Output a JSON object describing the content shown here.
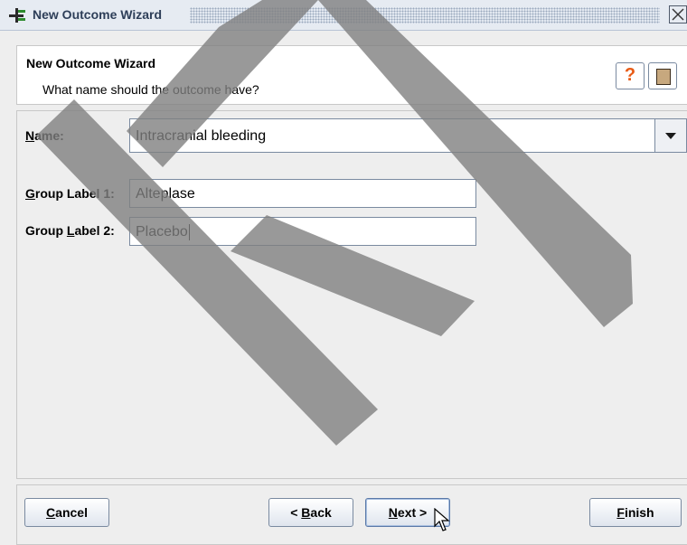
{
  "window": {
    "title": "New Outcome Wizard"
  },
  "header": {
    "title": "New Outcome Wizard",
    "subtitle": "What name should the outcome have?",
    "help_glyph": "?"
  },
  "form": {
    "name": {
      "label_mnemonic": "N",
      "label_rest": "ame:",
      "value": "Intracranial bleeding"
    },
    "group1": {
      "label_mnemonic": "G",
      "label_rest": "roup Label 1:",
      "value": "Alteplase"
    },
    "group2": {
      "label_pre": "Group ",
      "label_mnemonic": "L",
      "label_rest": "abel 2:",
      "value": "Placebo"
    }
  },
  "buttons": {
    "cancel": {
      "mnemonic": "C",
      "rest": "ancel"
    },
    "back": {
      "pre": "< ",
      "mnemonic": "B",
      "rest": "ack"
    },
    "next": {
      "mnemonic": "N",
      "rest": "ext >"
    },
    "finish": {
      "mnemonic": "F",
      "rest": "inish"
    }
  },
  "icons": {
    "title": "wizard-icon",
    "close": "close-icon",
    "help": "help-icon",
    "book": "book-icon",
    "dropdown": "chevron-down-icon",
    "cursor": "mouse-cursor-icon"
  }
}
